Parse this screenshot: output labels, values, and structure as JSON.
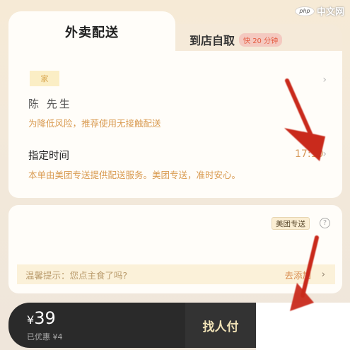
{
  "watermark": {
    "logo": "php",
    "text": "中文网"
  },
  "tabs": {
    "delivery_label": "外卖配送",
    "pickup_label": "到店自取",
    "pickup_badge": "快 20 分钟"
  },
  "address": {
    "tag": "家",
    "name": "陈 先生",
    "tip": "为降低风险，推荐使用无接触配送"
  },
  "schedule": {
    "label": "指定时间",
    "time": "17:10",
    "service_note": "本单由美团专送提供配送服务。美团专送，准时安心。"
  },
  "order_card": {
    "brand_badge": "美团专送",
    "reminder_text": "温馨提示：您点主食了吗?",
    "reminder_link": "去添加"
  },
  "checkout": {
    "currency": "¥",
    "price": "39",
    "discount": "已优惠 ¥4",
    "pay_button": "找人付"
  },
  "colors": {
    "accent_orange": "#d99a50",
    "arrow_red": "#d0281e",
    "pay_bar": "#2a2a2a"
  }
}
